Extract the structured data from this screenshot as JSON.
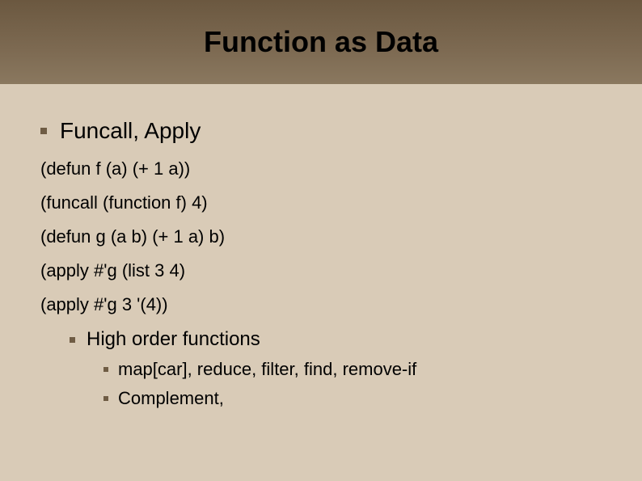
{
  "title": "Function as Data",
  "topic": "Funcall, Apply",
  "code": {
    "line1": "(defun f (a) (+ 1 a))",
    "line2": "(funcall (function f) 4)",
    "line3": "(defun g (a b) (+ 1 a) b)",
    "line4": "(apply #'g (list 3 4)",
    "line5": "(apply #'g 3 '(4))"
  },
  "sub": {
    "label": "High order functions",
    "items": [
      "map[car], reduce, filter, find, remove-if",
      "Complement,"
    ]
  }
}
